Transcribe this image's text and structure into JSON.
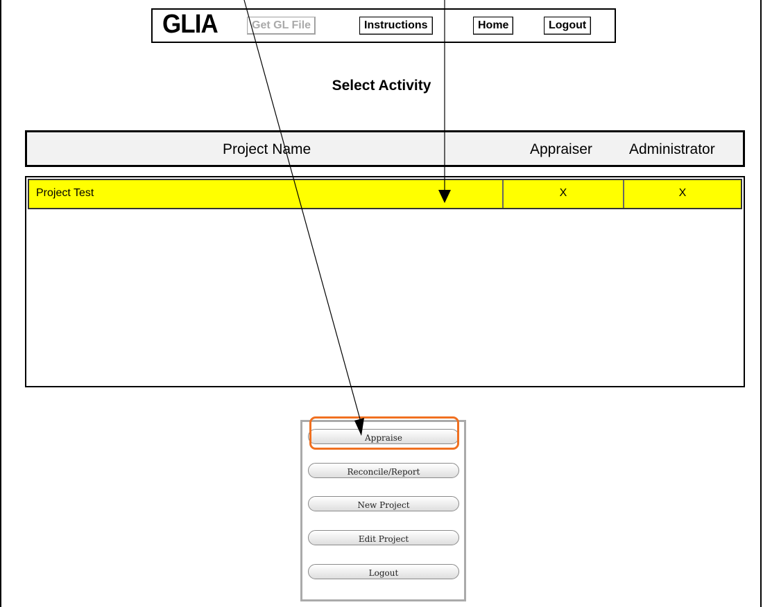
{
  "header": {
    "logo_text": "GLIA",
    "buttons": [
      {
        "label": "Get GL File",
        "enabled": false
      },
      {
        "label": "Instructions",
        "enabled": true
      },
      {
        "label": "Home",
        "enabled": true
      },
      {
        "label": "Logout",
        "enabled": true
      }
    ]
  },
  "page_title": "Select Activity",
  "table": {
    "columns": [
      "Project Name",
      "Appraiser",
      "Administrator"
    ],
    "rows": [
      {
        "name": "Project Test",
        "appraiser": "X",
        "administrator": "X",
        "selected": true
      }
    ]
  },
  "activities": {
    "buttons": [
      "Appraise",
      "Reconcile/Report",
      "New Project",
      "Edit Project",
      "Logout"
    ],
    "highlighted": "Appraise"
  },
  "colors": {
    "selected_row": "#ffff00",
    "highlight": "#f07020",
    "header_bg": "#f2f2f2"
  }
}
